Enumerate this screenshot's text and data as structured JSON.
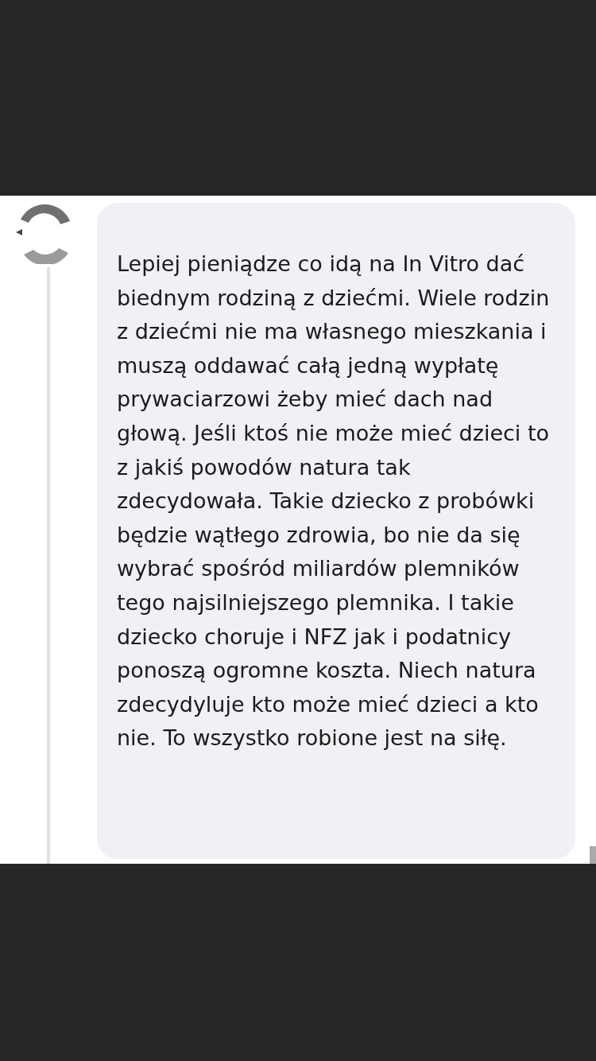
{
  "comment": {
    "text": "Lepiej pieniądze co idą na In Vitro dać biednym rodziną z dziećmi. Wiele rodzin z dziećmi nie ma własnego mieszkania i muszą oddawać całą jedną wypłatę prywaciarzowi żeby mieć dach nad głową. Jeśli ktoś nie może mieć dzieci to z jakiś powodów natura tak zdecydowała. Takie dziecko z probówki będzie wątłego zdrowia, bo nie da się wybrać spośród miliardów plemników tego najsilniejszego plemnika. I takie dziecko choruje i NFZ jak i podatnicy ponoszą ogromne koszta. Niech natura zdecydyluje kto może mieć dzieci a kto nie. To wszystko robione jest na siłę."
  }
}
